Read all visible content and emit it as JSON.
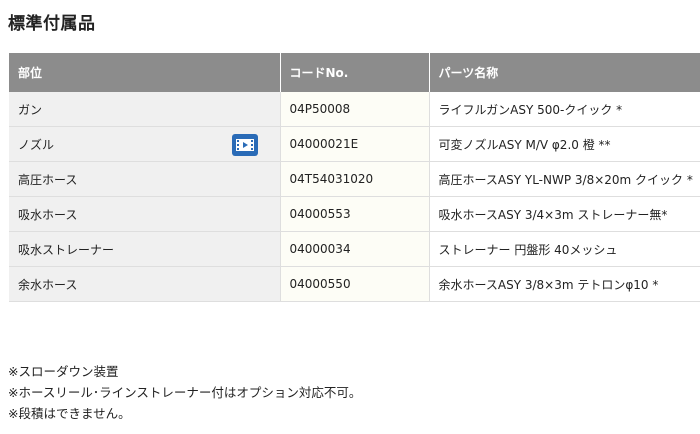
{
  "section": {
    "title": "標準付属品"
  },
  "table": {
    "headers": [
      "部位",
      "コードNo.",
      "パーツ名称"
    ],
    "rows": [
      {
        "part": "ガン",
        "code": "04P50008",
        "name": "ライフルガンASY 500-クイック *",
        "has_video": false
      },
      {
        "part": "ノズル",
        "code": "04000021E",
        "name": "可変ノズルASY M/V φ2.0 橙 **",
        "has_video": true
      },
      {
        "part": "高圧ホース",
        "code": "04T54031020",
        "name": "高圧ホースASY YL-NWP 3/8×20m クイック *",
        "has_video": false
      },
      {
        "part": "吸水ホース",
        "code": "04000553",
        "name": "吸水ホースASY 3/4×3m ストレーナー無*",
        "has_video": false
      },
      {
        "part": "吸水ストレーナー",
        "code": "04000034",
        "name": "ストレーナー 円盤形 40メッシュ",
        "has_video": false
      },
      {
        "part": "余水ホース",
        "code": "04000550",
        "name": "余水ホースASY 3/8×3m テトロンφ10 *",
        "has_video": false
      }
    ],
    "video_icon": "video-play-icon",
    "colors": {
      "header_bg": "#8c8c8c",
      "part_col_bg": "#f0f0f0",
      "code_col_bg": "#fdfdf6",
      "video_icon_bg": "#2a6bb7"
    }
  },
  "notes": [
    "※スローダウン装置",
    "※ホースリール･ラインストレーナー付はオプション対応不可。",
    "※段積はできません。"
  ]
}
